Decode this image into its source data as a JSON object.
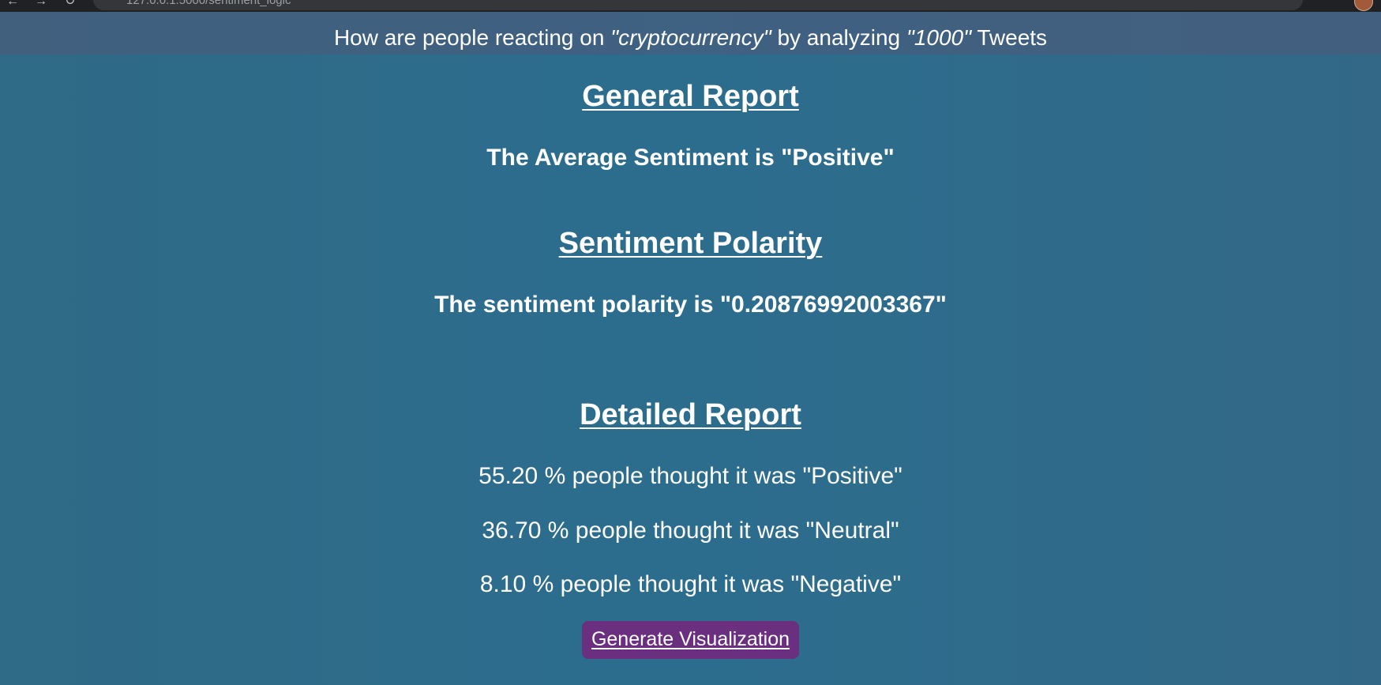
{
  "browser": {
    "url": "127.0.0.1:5000/sentiment_logic"
  },
  "header": {
    "prefix": "How are people reacting on ",
    "keyword": "\"cryptocurrency\"",
    "middle": " by analyzing ",
    "count": "\"1000\"",
    "suffix": " Tweets"
  },
  "general_report": {
    "title": "General Report",
    "text": "The Average Sentiment is \"Positive\""
  },
  "sentiment_polarity": {
    "title": "Sentiment Polarity",
    "text": "The sentiment polarity is \"0.20876992003367\""
  },
  "detailed_report": {
    "title": "Detailed Report",
    "lines": [
      "55.20 % people thought it was \"Positive\"",
      "36.70 % people thought it was \"Neutral\"",
      "8.10 % people thought it was \"Negative\""
    ]
  },
  "actions": {
    "generate_label": "Generate Visualization"
  },
  "colors": {
    "background": "#2c6d8e",
    "header_band": "#505878",
    "button": "#6a2f7f"
  }
}
